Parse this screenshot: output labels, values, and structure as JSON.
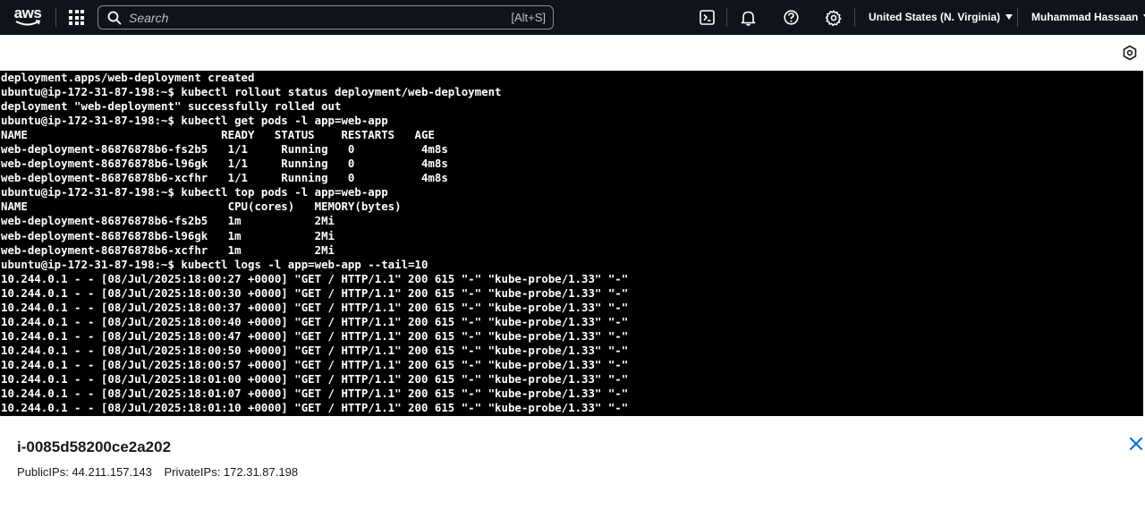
{
  "topnav": {
    "logo_text": "aws",
    "search_placeholder": "Search",
    "search_shortcut": "[Alt+S]",
    "region": "United States (N. Virginia)",
    "user": "Muhammad Hassaan",
    "icons": [
      "cloudshell-icon",
      "bell-icon",
      "help-icon",
      "gear-icon"
    ]
  },
  "terminal": {
    "lines": [
      "deployment.apps/web-deployment created",
      "ubuntu@ip-172-31-87-198:~$ kubectl rollout status deployment/web-deployment",
      "deployment \"web-deployment\" successfully rolled out",
      "ubuntu@ip-172-31-87-198:~$ kubectl get pods -l app=web-app",
      "NAME                             READY   STATUS    RESTARTS   AGE",
      "web-deployment-86876878b6-fs2b5   1/1     Running   0          4m8s",
      "web-deployment-86876878b6-l96gk   1/1     Running   0          4m8s",
      "web-deployment-86876878b6-xcfhr   1/1     Running   0          4m8s",
      "ubuntu@ip-172-31-87-198:~$ kubectl top pods -l app=web-app",
      "NAME                              CPU(cores)   MEMORY(bytes)",
      "web-deployment-86876878b6-fs2b5   1m           2Mi",
      "web-deployment-86876878b6-l96gk   1m           2Mi",
      "web-deployment-86876878b6-xcfhr   1m           2Mi",
      "ubuntu@ip-172-31-87-198:~$ kubectl logs -l app=web-app --tail=10",
      "10.244.0.1 - - [08/Jul/2025:18:00:27 +0000] \"GET / HTTP/1.1\" 200 615 \"-\" \"kube-probe/1.33\" \"-\"",
      "10.244.0.1 - - [08/Jul/2025:18:00:30 +0000] \"GET / HTTP/1.1\" 200 615 \"-\" \"kube-probe/1.33\" \"-\"",
      "10.244.0.1 - - [08/Jul/2025:18:00:37 +0000] \"GET / HTTP/1.1\" 200 615 \"-\" \"kube-probe/1.33\" \"-\"",
      "10.244.0.1 - - [08/Jul/2025:18:00:40 +0000] \"GET / HTTP/1.1\" 200 615 \"-\" \"kube-probe/1.33\" \"-\"",
      "10.244.0.1 - - [08/Jul/2025:18:00:47 +0000] \"GET / HTTP/1.1\" 200 615 \"-\" \"kube-probe/1.33\" \"-\"",
      "10.244.0.1 - - [08/Jul/2025:18:00:50 +0000] \"GET / HTTP/1.1\" 200 615 \"-\" \"kube-probe/1.33\" \"-\"",
      "10.244.0.1 - - [08/Jul/2025:18:00:57 +0000] \"GET / HTTP/1.1\" 200 615 \"-\" \"kube-probe/1.33\" \"-\"",
      "10.244.0.1 - - [08/Jul/2025:18:01:00 +0000] \"GET / HTTP/1.1\" 200 615 \"-\" \"kube-probe/1.33\" \"-\"",
      "10.244.0.1 - - [08/Jul/2025:18:01:07 +0000] \"GET / HTTP/1.1\" 200 615 \"-\" \"kube-probe/1.33\" \"-\"",
      "10.244.0.1 - - [08/Jul/2025:18:01:10 +0000] \"GET / HTTP/1.1\" 200 615 \"-\" \"kube-probe/1.33\" \"-\""
    ]
  },
  "instance": {
    "id": "i-0085d58200ce2a202",
    "public_ips": "PublicIPs: 44.211.157.143",
    "private_ips": "PrivateIPs: 172.31.87.198"
  },
  "colors": {
    "nav_bg": "#0f141a",
    "terminal_bg": "#000000",
    "accent_blue": "#0972d3"
  }
}
